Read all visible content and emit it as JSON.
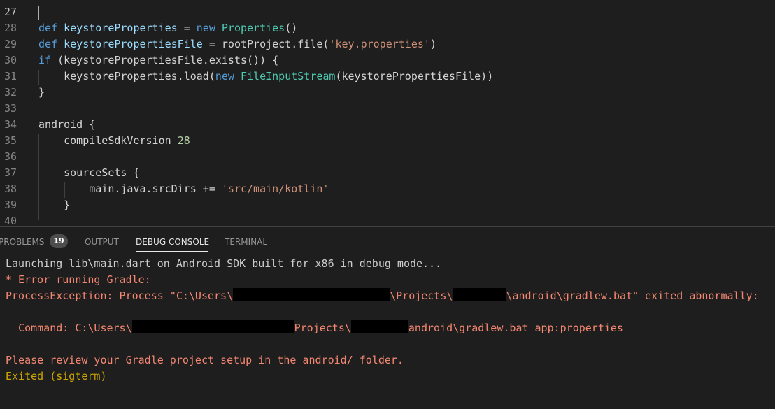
{
  "editor": {
    "lines": [
      {
        "n": "27",
        "active": true,
        "parts": []
      },
      {
        "n": "28",
        "parts": [
          [
            "kw",
            "def "
          ],
          [
            "var",
            "keystoreProperties"
          ],
          [
            "plain",
            " = "
          ],
          [
            "kw",
            "new "
          ],
          [
            "cls",
            "Properties"
          ],
          [
            "plain",
            "()"
          ]
        ]
      },
      {
        "n": "29",
        "parts": [
          [
            "kw",
            "def "
          ],
          [
            "var",
            "keystorePropertiesFile"
          ],
          [
            "plain",
            " = rootProject.file("
          ],
          [
            "str",
            "'key.properties'"
          ],
          [
            "plain",
            ")"
          ]
        ]
      },
      {
        "n": "30",
        "parts": [
          [
            "kw",
            "if"
          ],
          [
            "plain",
            " (keystorePropertiesFile.exists()) {"
          ]
        ]
      },
      {
        "n": "31",
        "parts": [
          [
            "plain",
            "    keystoreProperties.load("
          ],
          [
            "kw",
            "new "
          ],
          [
            "cls",
            "FileInputStream"
          ],
          [
            "plain",
            "(keystorePropertiesFile))"
          ]
        ]
      },
      {
        "n": "32",
        "parts": [
          [
            "plain",
            "}"
          ]
        ]
      },
      {
        "n": "33",
        "parts": []
      },
      {
        "n": "34",
        "parts": [
          [
            "plain",
            "android {"
          ]
        ]
      },
      {
        "n": "35",
        "parts": [
          [
            "plain",
            "    compileSdkVersion "
          ],
          [
            "num",
            "28"
          ]
        ]
      },
      {
        "n": "36",
        "parts": []
      },
      {
        "n": "37",
        "parts": [
          [
            "plain",
            "    sourceSets {"
          ]
        ]
      },
      {
        "n": "38",
        "parts": [
          [
            "plain",
            "        main.java.srcDirs += "
          ],
          [
            "str",
            "'src/main/kotlin'"
          ]
        ]
      },
      {
        "n": "39",
        "parts": [
          [
            "plain",
            "    }"
          ]
        ]
      },
      {
        "n": "40",
        "parts": []
      }
    ]
  },
  "panel": {
    "tabs": [
      {
        "label": "PROBLEMS",
        "active": false
      },
      {
        "label": "OUTPUT",
        "active": false
      },
      {
        "label": "DEBUG CONSOLE",
        "active": true
      },
      {
        "label": "TERMINAL",
        "active": false
      }
    ],
    "problems_count": "19",
    "console": {
      "line1": "Launching lib\\main.dart on Android SDK built for x86 in debug mode...",
      "line2": "* Error running Gradle:",
      "line3a": "ProcessException: Process \"C:\\Users\\",
      "line3b": "\\Projects\\",
      "line3c": "\\android\\gradlew.bat\" exited abnormally:",
      "line4a": "  Command: C:\\Users\\",
      "line4b": "Projects\\",
      "line4c": "android\\gradlew.bat app:properties",
      "line5": "Please review your Gradle project setup in the android/ folder.",
      "line6": "Exited (sigterm)"
    }
  }
}
